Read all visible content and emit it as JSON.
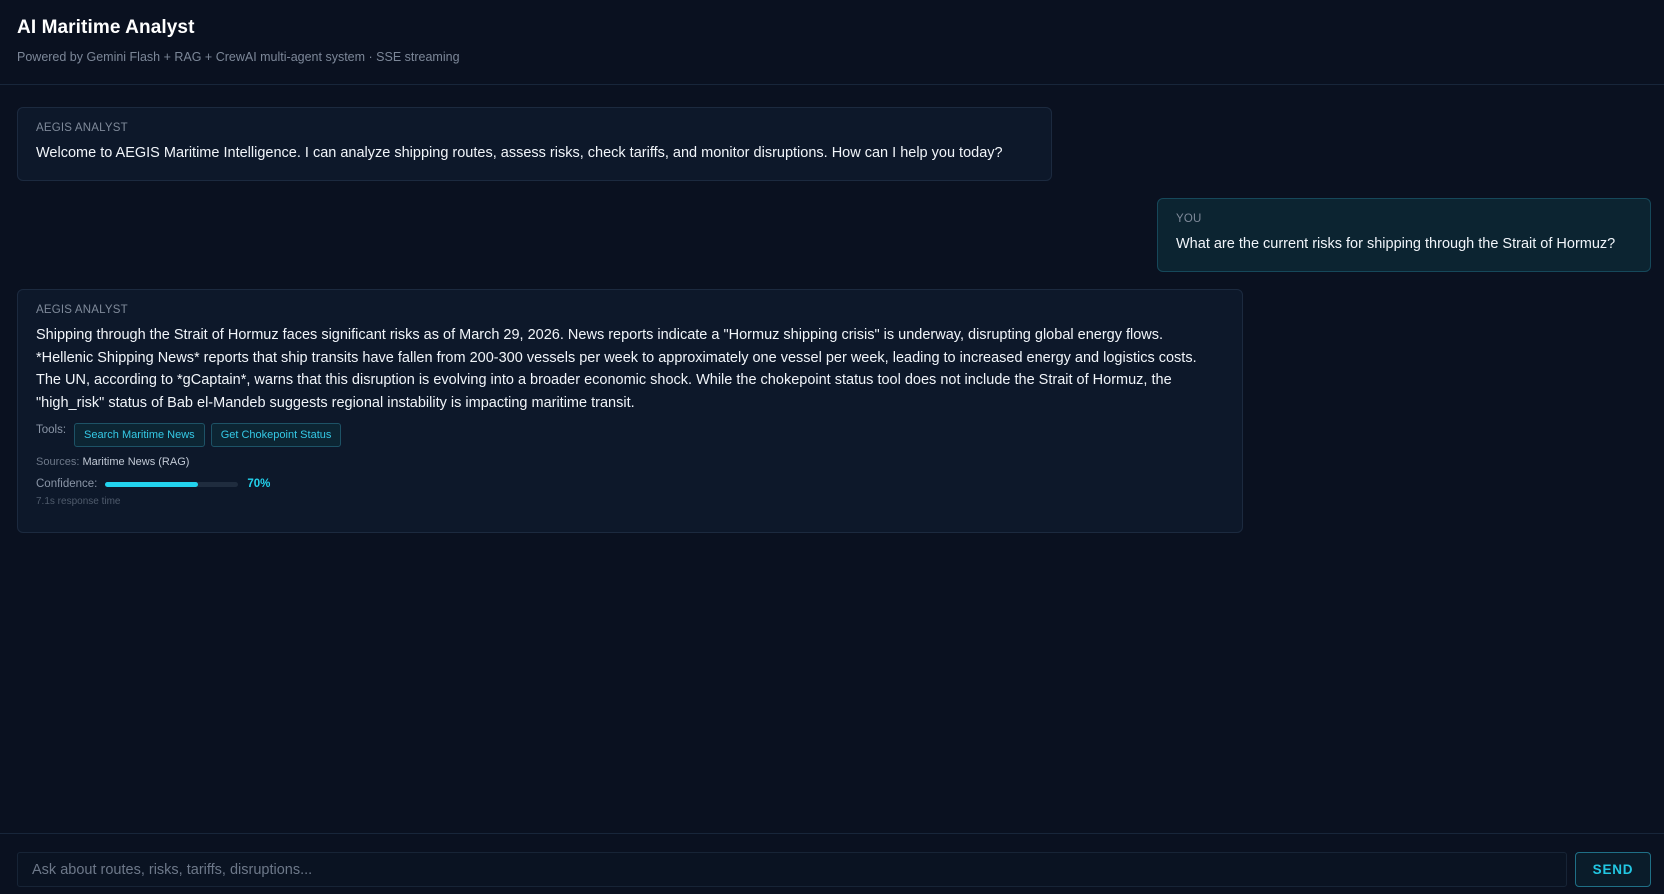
{
  "header": {
    "title": "AI Maritime Analyst",
    "subtitle": "Powered by Gemini Flash + RAG + CrewAI multi-agent system · SSE streaming"
  },
  "messages": [
    {
      "role": "AEGIS ANALYST",
      "text": "Welcome to AEGIS Maritime Intelligence. I can analyze shipping routes, assess risks, check tariffs, and monitor disruptions. How can I help you today?"
    },
    {
      "role": "YOU",
      "text": "What are the current risks for shipping through the Strait of Hormuz?"
    },
    {
      "role": "AEGIS ANALYST",
      "text": "Shipping through the Strait of Hormuz faces significant risks as of March 29, 2026. News reports indicate a \"Hormuz shipping crisis\" is underway, disrupting global energy flows. *Hellenic Shipping News* reports that ship transits have fallen from 200-300 vessels per week to approximately one vessel per week, leading to increased energy and logistics costs. The UN, according to *gCaptain*, warns that this disruption is evolving into a broader economic shock. While the chokepoint status tool does not include the Strait of Hormuz, the \"high_risk\" status of Bab el-Mandeb suggests regional instability is impacting maritime transit.",
      "tools_label": "Tools:",
      "tools": [
        "Search Maritime News",
        "Get Chokepoint Status"
      ],
      "sources_label": "Sources:",
      "sources": "Maritime News (RAG)",
      "confidence_label": "Confidence:",
      "confidence_value": 0.7,
      "confidence_text": "70%",
      "response_time": "7.1s response time"
    }
  ],
  "composer": {
    "placeholder": "Ask about routes, risks, tariffs, disruptions...",
    "value": "",
    "send_label": "SEND"
  },
  "colors": {
    "background": "#0a1120",
    "accent": "#22d3ee",
    "user_bubble": "#0c2431",
    "analyst_bubble": "#0d182a"
  }
}
